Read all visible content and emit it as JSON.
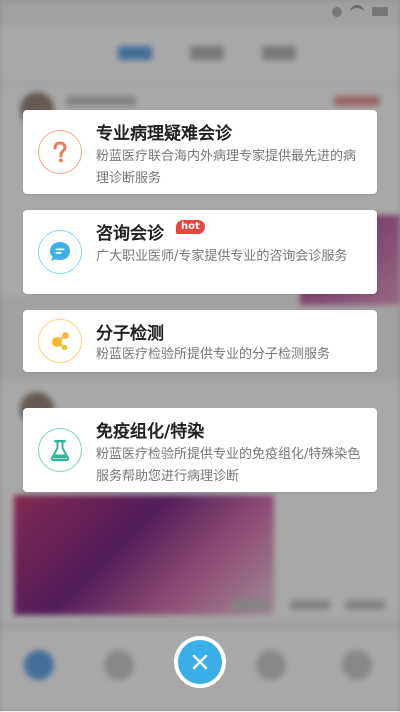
{
  "services": [
    {
      "title": "专业病理疑难会诊",
      "description": "粉蓝医疗联合海内外病理专家提供最先进的病理诊断服务",
      "icon": "question-icon",
      "icon_color": "#ee7a5c"
    },
    {
      "title": "咨询会诊",
      "badge": "hot",
      "description": "广大职业医师/专家提供专业的咨询会诊服务",
      "icon": "chat-bubble-icon",
      "icon_color": "#3fb0e6"
    },
    {
      "title": "分子检测",
      "description": "粉蓝医疗检验所提供专业的分子检测服务",
      "icon": "molecule-icon",
      "icon_color": "#f4b92c"
    },
    {
      "title": "免疫组化/特染",
      "description": "粉蓝医疗检验所提供专业的免疫组化/特殊染色服务帮助您进行病理诊断",
      "icon": "flask-icon",
      "icon_color": "#2fb59b"
    }
  ],
  "close_button": {
    "icon": "close-icon",
    "color": "#3aaee8"
  }
}
